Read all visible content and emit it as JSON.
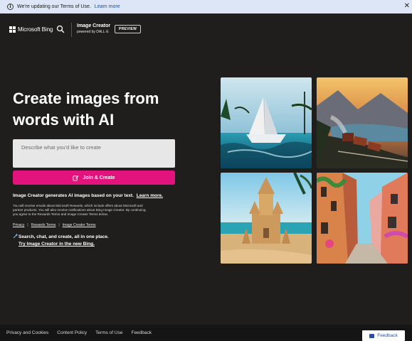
{
  "notice": {
    "text": "We're updating our Terms of Use.",
    "link": "Learn more",
    "info_icon": "info-icon",
    "close_icon": "close-icon"
  },
  "header": {
    "logo_text": "Microsoft Bing",
    "product_name": "Image Creator",
    "powered_by": "powered by DALL·E",
    "badge": "PREVIEW"
  },
  "hero": {
    "title": "Create images from words with AI",
    "prompt_placeholder": "Describe what you'd like to create",
    "join_button": "Join & Create",
    "description": "Image Creator generates AI images based on your text.",
    "learn_more": "Learn more.",
    "fine_print": "You will receive emails about Microsoft Rewards, which include offers about Microsoft and partner products. You will also receive notifications about Bing Image Creator. By continuing, you agree to the Rewards Terms and Image Creator Terms below.",
    "legal_links": [
      "Privacy",
      "Rewards Terms",
      "Image Creator Terms"
    ],
    "promo_line1": "Search, chat, and create, all in one place.",
    "promo_line2": "Try Image Creator in the new Bing."
  },
  "gallery": [
    {
      "subject": "paper sailboat on the sea"
    },
    {
      "subject": "train along a mountain lake at sunset"
    },
    {
      "subject": "sand castle on a beach"
    },
    {
      "subject": "colorful village street"
    }
  ],
  "footer": {
    "links": [
      "Privacy and Cookies",
      "Content Policy",
      "Terms of Use",
      "Feedback"
    ],
    "feedback_button": "Feedback"
  },
  "colors": {
    "background": "#1f1e1d",
    "accent": "#e3137d",
    "banner": "#dce6f6",
    "link": "#0b51c5"
  }
}
